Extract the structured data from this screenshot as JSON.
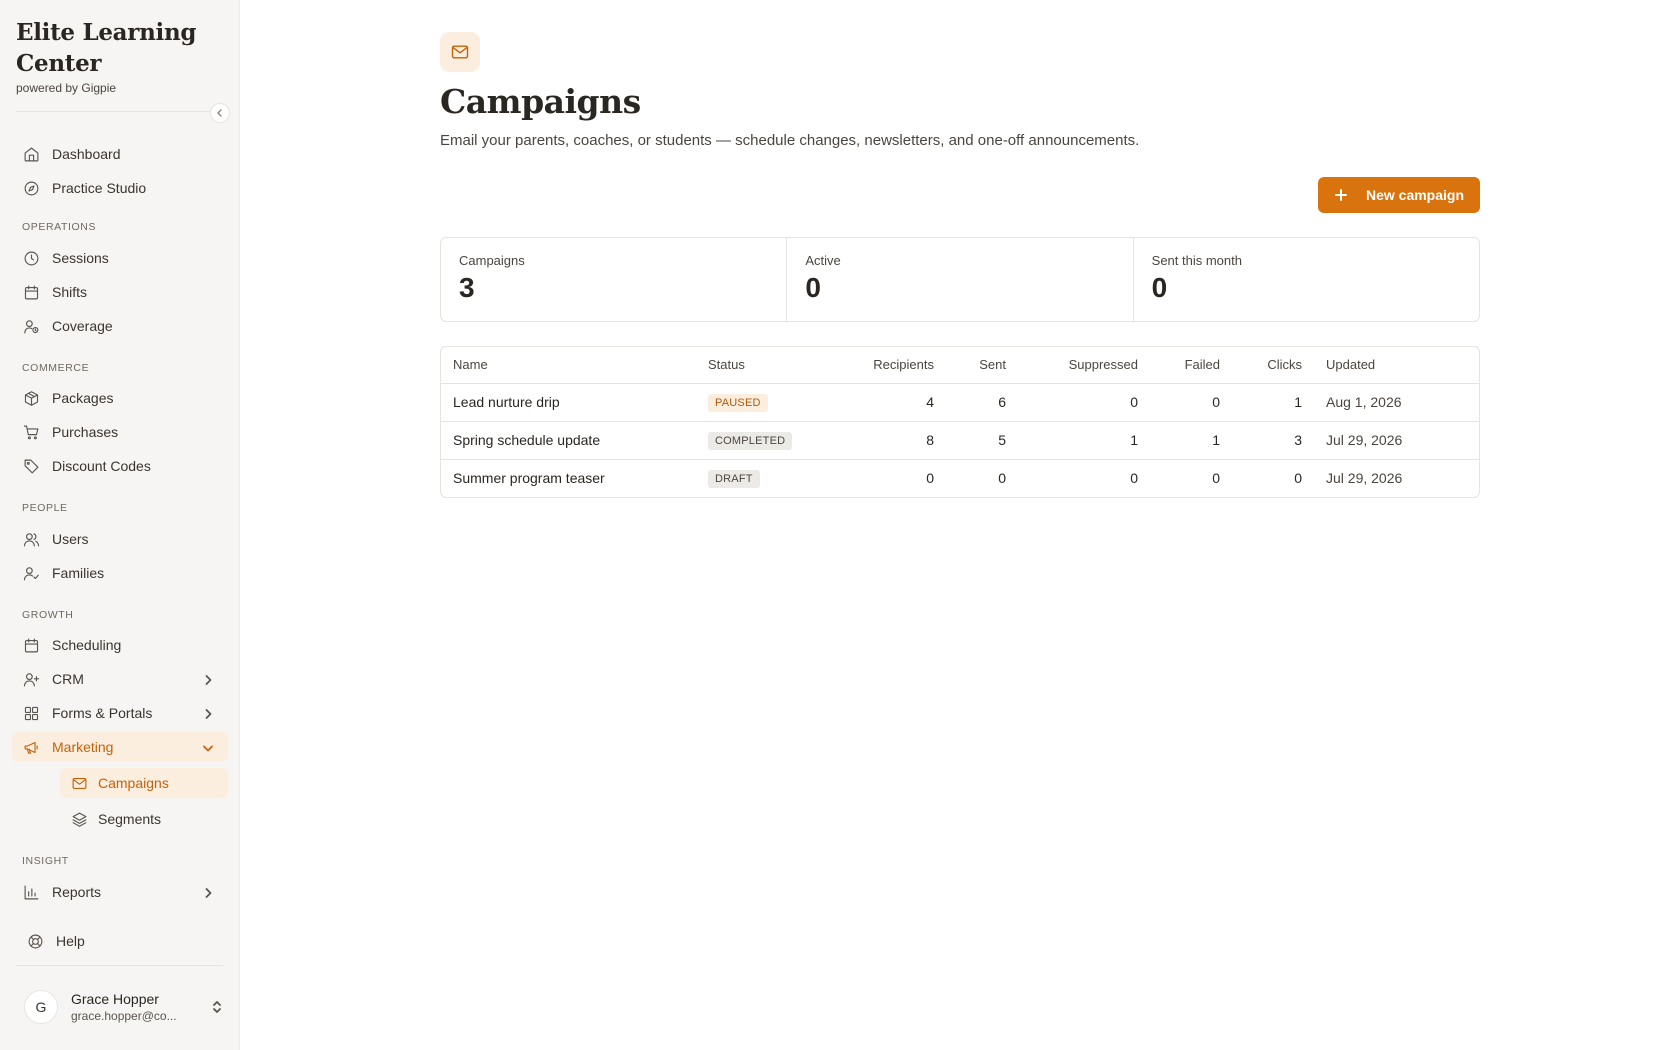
{
  "brand": {
    "title_line1": "Elite Learning",
    "title_line2": "Center",
    "subtitle": "powered by Gigpie"
  },
  "sidebar": {
    "top_items": [
      {
        "label": "Dashboard",
        "icon": "home-icon"
      },
      {
        "label": "Practice Studio",
        "icon": "compass-icon"
      }
    ],
    "sections": {
      "operations": "OPERATIONS",
      "commerce": "COMMERCE",
      "people": "PEOPLE",
      "growth": "GROWTH",
      "insight": "INSIGHT"
    },
    "operations_items": [
      {
        "label": "Sessions",
        "icon": "clock-icon"
      },
      {
        "label": "Shifts",
        "icon": "calendar-icon"
      },
      {
        "label": "Coverage",
        "icon": "user-clock-icon"
      }
    ],
    "commerce_items": [
      {
        "label": "Packages",
        "icon": "package-icon"
      },
      {
        "label": "Purchases",
        "icon": "cart-icon"
      },
      {
        "label": "Discount Codes",
        "icon": "tag-icon"
      }
    ],
    "people_items": [
      {
        "label": "Users",
        "icon": "users-icon"
      },
      {
        "label": "Families",
        "icon": "user-check-icon"
      }
    ],
    "growth_items": [
      {
        "label": "Scheduling",
        "icon": "calendar-icon"
      },
      {
        "label": "CRM",
        "icon": "user-plus-icon"
      },
      {
        "label": "Forms & Portals",
        "icon": "grid-icon"
      },
      {
        "label": "Marketing",
        "icon": "megaphone-icon"
      }
    ],
    "marketing_sub": [
      {
        "label": "Campaigns",
        "icon": "mail-icon"
      },
      {
        "label": "Segments",
        "icon": "layers-icon"
      }
    ],
    "insight_items": [
      {
        "label": "Reports",
        "icon": "bar-chart-icon"
      }
    ],
    "help": {
      "label": "Help",
      "icon": "lifebuoy-icon"
    },
    "accent_color": "#c4620a",
    "active_bg": "#fbeede"
  },
  "user": {
    "initial": "G",
    "name": "Grace Hopper",
    "email": "grace.hopper@co..."
  },
  "header": {
    "title": "Campaigns",
    "subtitle": "Email your parents, coaches, or students — schedule changes, newsletters, and one-off announcements.",
    "new_button": "New campaign",
    "icon": "mail-icon",
    "button_color": "#d9730d"
  },
  "stats": [
    {
      "label": "Campaigns",
      "value": "3"
    },
    {
      "label": "Active",
      "value": "0"
    },
    {
      "label": "Sent this month",
      "value": "0"
    }
  ],
  "table": {
    "columns": [
      "Name",
      "Status",
      "Recipients",
      "Sent",
      "Suppressed",
      "Failed",
      "Clicks",
      "Updated"
    ],
    "rows": [
      {
        "name": "Lead nurture drip",
        "status": "PAUSED",
        "status_bg": "#fbeede",
        "status_color": "#b4580a",
        "recipients": "4",
        "sent": "6",
        "suppressed": "0",
        "failed": "0",
        "clicks": "1",
        "updated": "Aug 1, 2026"
      },
      {
        "name": "Spring schedule update",
        "status": "COMPLETED",
        "status_bg": "#eceae6",
        "status_color": "#4a4540",
        "recipients": "8",
        "sent": "5",
        "suppressed": "1",
        "failed": "1",
        "clicks": "3",
        "updated": "Jul 29, 2026"
      },
      {
        "name": "Summer program teaser",
        "status": "DRAFT",
        "status_bg": "#eceae6",
        "status_color": "#4a4540",
        "recipients": "0",
        "sent": "0",
        "suppressed": "0",
        "failed": "0",
        "clicks": "0",
        "updated": "Jul 29, 2026"
      }
    ]
  }
}
